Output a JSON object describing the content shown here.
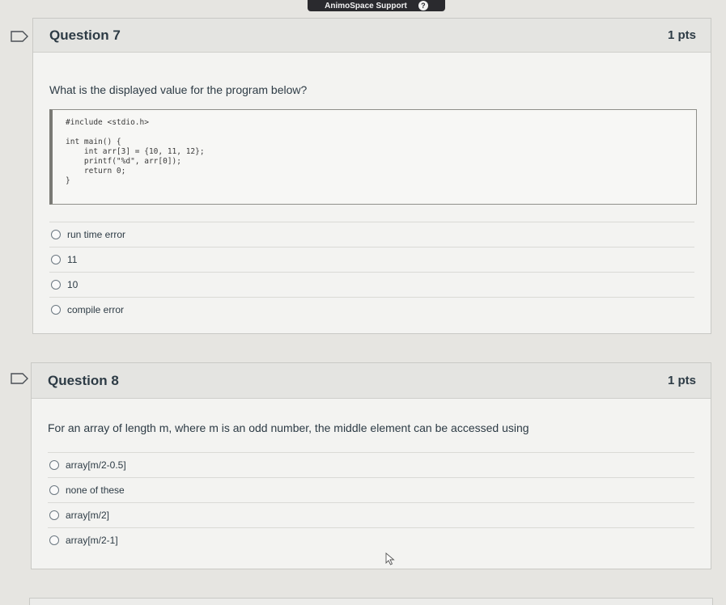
{
  "topbar": {
    "support_label": "AnimoSpace Support",
    "help_icon": "?"
  },
  "questions": [
    {
      "title": "Question 7",
      "points": "1 pts",
      "prompt": "What is the displayed value for the program below?",
      "code": "#include <stdio.h>\n\nint main() {\n    int arr[3] = {10, 11, 12};\n    printf(\"%d\", arr[0]);\n    return 0;\n}",
      "answers": [
        "run time error",
        "11",
        "10",
        "compile error"
      ]
    },
    {
      "title": "Question 8",
      "points": "1 pts",
      "prompt": "For an array of length m, where m is an odd number, the middle element can be accessed using",
      "answers": [
        "array[m/2-0.5]",
        "none of these",
        "array[m/2]",
        "array[m/2-1]"
      ]
    }
  ]
}
